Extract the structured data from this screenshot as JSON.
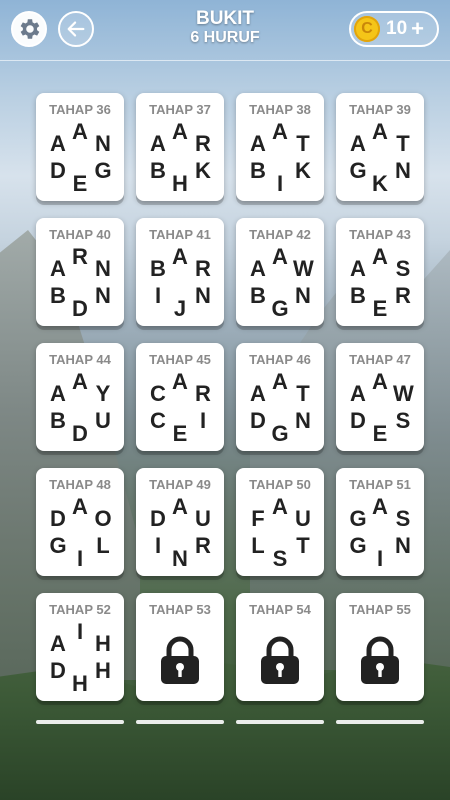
{
  "header": {
    "title": "BUKIT",
    "subtitle": "6 HURUF",
    "coins": "10",
    "plus": "+",
    "coin_symbol": "C"
  },
  "levels": [
    {
      "label": "TAHAP 36",
      "letters": [
        "A",
        "A",
        "N",
        "D",
        "G",
        "E"
      ],
      "locked": false
    },
    {
      "label": "TAHAP 37",
      "letters": [
        "A",
        "A",
        "R",
        "B",
        "K",
        "H"
      ],
      "locked": false
    },
    {
      "label": "TAHAP 38",
      "letters": [
        "A",
        "A",
        "T",
        "B",
        "K",
        "I"
      ],
      "locked": false
    },
    {
      "label": "TAHAP 39",
      "letters": [
        "A",
        "A",
        "T",
        "G",
        "N",
        "K"
      ],
      "locked": false
    },
    {
      "label": "TAHAP 40",
      "letters": [
        "R",
        "A",
        "N",
        "B",
        "N",
        "D"
      ],
      "locked": false
    },
    {
      "label": "TAHAP 41",
      "letters": [
        "A",
        "B",
        "R",
        "I",
        "N",
        "J"
      ],
      "locked": false
    },
    {
      "label": "TAHAP 42",
      "letters": [
        "A",
        "A",
        "W",
        "B",
        "N",
        "G"
      ],
      "locked": false
    },
    {
      "label": "TAHAP 43",
      "letters": [
        "A",
        "A",
        "S",
        "B",
        "R",
        "E"
      ],
      "locked": false
    },
    {
      "label": "TAHAP 44",
      "letters": [
        "A",
        "A",
        "Y",
        "B",
        "U",
        "D"
      ],
      "locked": false
    },
    {
      "label": "TAHAP 45",
      "letters": [
        "A",
        "C",
        "R",
        "C",
        "I",
        "E"
      ],
      "locked": false
    },
    {
      "label": "TAHAP 46",
      "letters": [
        "A",
        "A",
        "T",
        "D",
        "N",
        "G"
      ],
      "locked": false
    },
    {
      "label": "TAHAP 47",
      "letters": [
        "A",
        "A",
        "W",
        "D",
        "S",
        "E"
      ],
      "locked": false
    },
    {
      "label": "TAHAP 48",
      "letters": [
        "A",
        "D",
        "O",
        "G",
        "L",
        "I"
      ],
      "locked": false
    },
    {
      "label": "TAHAP 49",
      "letters": [
        "A",
        "D",
        "U",
        "I",
        "R",
        "N"
      ],
      "locked": false
    },
    {
      "label": "TAHAP 50",
      "letters": [
        "A",
        "F",
        "U",
        "L",
        "T",
        "S"
      ],
      "locked": false
    },
    {
      "label": "TAHAP 51",
      "letters": [
        "A",
        "G",
        "S",
        "G",
        "N",
        "I"
      ],
      "locked": false
    },
    {
      "label": "TAHAP 52",
      "letters": [
        "I",
        "A",
        "H",
        "D",
        "H",
        "H"
      ],
      "locked": false
    },
    {
      "label": "TAHAP 53",
      "letters": [],
      "locked": true
    },
    {
      "label": "TAHAP 54",
      "letters": [],
      "locked": true
    },
    {
      "label": "TAHAP 55",
      "letters": [],
      "locked": true
    }
  ],
  "icons": {
    "settings": "gear-icon",
    "back": "back-arrow-icon",
    "coin": "coin-icon",
    "lock": "lock-icon"
  },
  "colors": {
    "coin": "#f5c518",
    "card": "#ffffff",
    "label": "#8a8a8a",
    "letter": "#222222"
  }
}
